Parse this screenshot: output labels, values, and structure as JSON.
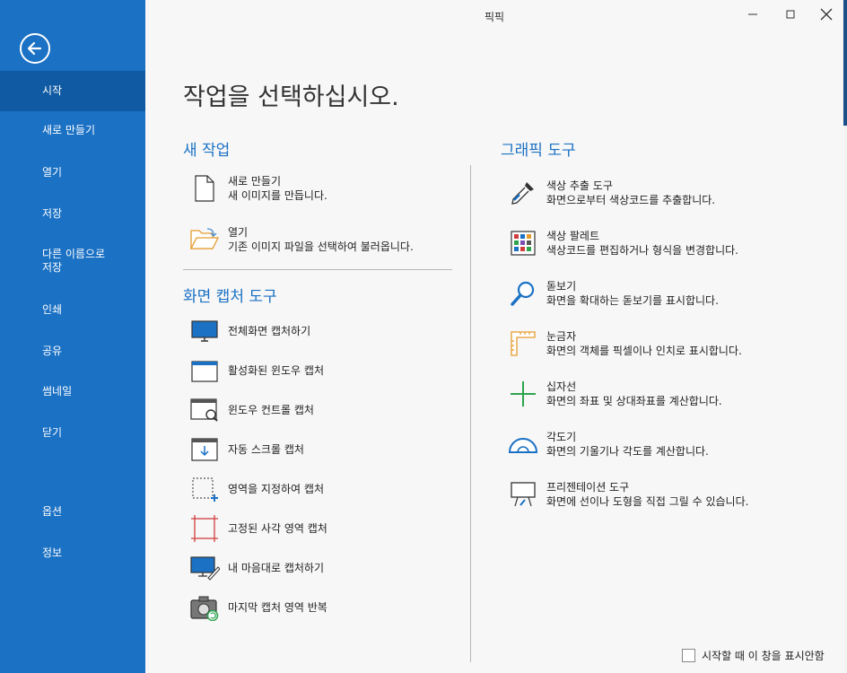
{
  "window": {
    "title": "픽픽"
  },
  "sidebar": {
    "items": [
      {
        "label": "시작",
        "active": true
      },
      {
        "label": "새로 만들기"
      },
      {
        "label": "열기"
      },
      {
        "label": "저장"
      },
      {
        "label": "다른 이름으로\n저장"
      },
      {
        "label": "인쇄"
      },
      {
        "label": "공유"
      },
      {
        "label": "썸네일"
      },
      {
        "label": "닫기"
      },
      {
        "label": "옵션"
      },
      {
        "label": "정보"
      }
    ]
  },
  "main": {
    "heading": "작업을 선택하십시오.",
    "new_task": {
      "title": "새 작업",
      "items": [
        {
          "icon": "blank-page-icon",
          "title": "새로 만들기",
          "desc": "새 이미지를 만듭니다."
        },
        {
          "icon": "open-folder-icon",
          "title": "열기",
          "desc": "기존 이미지 파일을 선택하여 불러옵니다."
        }
      ]
    },
    "capture": {
      "title": "화면 캡처 도구",
      "items": [
        {
          "icon": "monitor-icon",
          "label": "전체화면 캡처하기"
        },
        {
          "icon": "window-icon",
          "label": "활성화된 윈도우 캡처"
        },
        {
          "icon": "window-control-icon",
          "label": "윈도우 컨트롤 캡처"
        },
        {
          "icon": "scroll-capture-icon",
          "label": "자동 스크롤 캡처"
        },
        {
          "icon": "region-select-icon",
          "label": "영역을 지정하여 캡처"
        },
        {
          "icon": "fixed-region-icon",
          "label": "고정된 사각 영역 캡처"
        },
        {
          "icon": "freehand-icon",
          "label": "내 마음대로 캡처하기"
        },
        {
          "icon": "camera-repeat-icon",
          "label": "마지막 캡처 영역 반복"
        }
      ]
    },
    "graphics": {
      "title": "그래픽 도구",
      "items": [
        {
          "icon": "eyedropper-icon",
          "title": "색상 추출 도구",
          "desc": "화면으로부터 색상코드를 추출합니다."
        },
        {
          "icon": "palette-icon",
          "title": "색상 팔레트",
          "desc": "색상코드를 편집하거나 형식을 변경합니다."
        },
        {
          "icon": "magnifier-icon",
          "title": "돋보기",
          "desc": "화면을 확대하는 돋보기를 표시합니다."
        },
        {
          "icon": "ruler-icon",
          "title": "눈금자",
          "desc": "화면의 객체를 픽셀이나 인치로 표시합니다."
        },
        {
          "icon": "crosshair-icon",
          "title": "십자선",
          "desc": "화면의 좌표 및 상대좌표를 계산합니다."
        },
        {
          "icon": "protractor-icon",
          "title": "각도기",
          "desc": "화면의 기울기나 각도를 계산합니다."
        },
        {
          "icon": "whiteboard-icon",
          "title": "프리젠테이션 도구",
          "desc": "화면에 선이나 도형을 직접 그릴 수 있습니다."
        }
      ]
    },
    "footer": {
      "checkbox_label": "시작할 때 이 창을 표시안함",
      "checked": false
    }
  },
  "colors": {
    "sidebar": "#1b71c4",
    "sidebar_active": "#0f5aa2",
    "accent": "#1b71c4"
  }
}
